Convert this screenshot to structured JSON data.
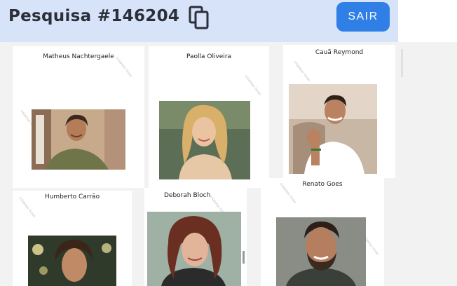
{
  "header": {
    "title": "Pesquisa #146204",
    "exit_label": "SAIR",
    "copy_icon": "copy-icon"
  },
  "cards": [
    {
      "name": "Matheus Nachtergaele"
    },
    {
      "name": "Paolla Oliveira"
    },
    {
      "name": "Cauã Reymond"
    },
    {
      "name": "Humberto Carrão"
    },
    {
      "name": "Deborah Bloch"
    },
    {
      "name": "Renato Goes"
    }
  ],
  "colors": {
    "header_bg": "#d7e3f8",
    "accent": "#2f7fe6",
    "title": "#2c2f3a"
  }
}
